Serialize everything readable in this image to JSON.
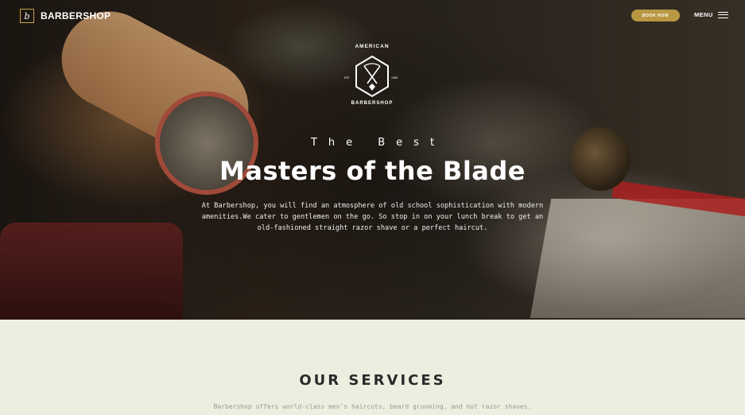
{
  "nav": {
    "logo_mark": "b",
    "logo_text": "BARBERSHOP",
    "book_label": "BOOK NOW",
    "menu_label": "MENU"
  },
  "hero": {
    "badge": {
      "top": "AMERICAN",
      "bottom": "BARBERSHOP",
      "left_small": "EST",
      "right_small": "1965"
    },
    "eyebrow": "The Best",
    "headline": "Masters of the Blade",
    "intro": "At Barbershop, you will find an atmosphere of old school sophistication with modern amenities.We cater to gentlemen on the go. So stop in on your lunch break to get an old-fashioned straight razor shave or a perfect haircut."
  },
  "services": {
    "title": "OUR SERVICES",
    "subtitle": "Barbershop offers world-class men's haircuts, beard grooming, and hot razor shaves."
  },
  "colors": {
    "accent": "#b99844",
    "services_bg": "#ecefe0"
  },
  "icons": [
    "hamburger-icon",
    "barbershop-badge-icon"
  ]
}
